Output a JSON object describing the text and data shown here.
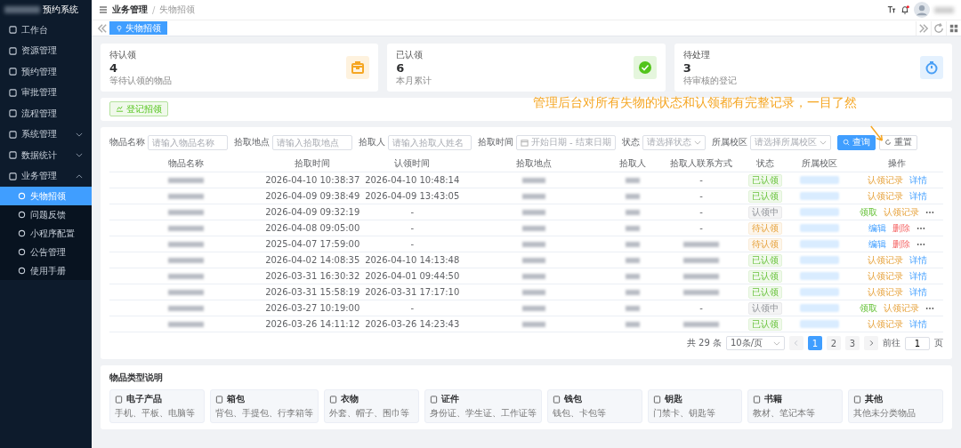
{
  "sidebar": {
    "title": "预约系统",
    "items": [
      {
        "label": "工作台"
      },
      {
        "label": "资源管理"
      },
      {
        "label": "预约管理"
      },
      {
        "label": "审批管理"
      },
      {
        "label": "流程管理"
      },
      {
        "label": "系统管理",
        "expanded": false
      },
      {
        "label": "数据统计",
        "expanded": false
      },
      {
        "label": "业务管理",
        "expanded": true,
        "children": [
          {
            "label": "失物招领",
            "selected": true
          },
          {
            "label": "问题反馈",
            "selected": false
          },
          {
            "label": "小程序配置",
            "selected": false
          },
          {
            "label": "公告管理",
            "selected": false
          },
          {
            "label": "使用手册",
            "selected": false
          }
        ]
      }
    ]
  },
  "breadcrumb": [
    "业务管理",
    "失物招领"
  ],
  "breadcrumb_separator": "/",
  "header": {
    "notification": true
  },
  "tabs": [
    {
      "label": "失物招领",
      "selected": true
    }
  ],
  "stats": [
    {
      "title": "待认领",
      "value": "4",
      "sub": "等待认领的物品",
      "kind": "box",
      "color": "#f5a623"
    },
    {
      "title": "已认领",
      "value": "6",
      "sub": "本月累计",
      "kind": "check",
      "color": "#52c41a"
    },
    {
      "title": "待处理",
      "value": "3",
      "sub": "待审核的登记",
      "kind": "timer",
      "color": "#4a9ff5"
    }
  ],
  "register_button": "登记招领",
  "annotation": "管理后台对所有失物的状态和认领都有完整记录，一目了然",
  "filters": [
    {
      "label": "物品名称",
      "placeholder": "请输入物品名称",
      "kind": "text"
    },
    {
      "label": "拾取地点",
      "placeholder": "请输入拾取地点",
      "kind": "text"
    },
    {
      "label": "拾取人",
      "placeholder": "请输入拾取人姓名",
      "kind": "text"
    },
    {
      "label": "拾取时间",
      "placeholder": "开始日期",
      "placeholder_end": "结束日期",
      "separator": "-",
      "kind": "daterange"
    },
    {
      "label": "状态",
      "placeholder": "请选择状态",
      "kind": "select"
    },
    {
      "label": "所属校区",
      "placeholder": "请选择所属校区",
      "kind": "select"
    }
  ],
  "search_button": "查询",
  "reset_button": "重置",
  "table": {
    "columns": [
      "物品名称",
      "拾取时间",
      "认领时间",
      "拾取地点",
      "拾取人",
      "拾取人联系方式",
      "状态",
      "所属校区",
      "操作"
    ],
    "rows": [
      {
        "picked": "2026-04-10 10:38:37",
        "claimed": "2026-04-10 10:48:14",
        "contact": "-",
        "status": {
          "label": "已认领",
          "kind": "claimed"
        },
        "actions": [
          {
            "label": "认领记录",
            "kind": "warning"
          },
          {
            "label": "详情",
            "kind": "primary"
          }
        ]
      },
      {
        "picked": "2026-04-09 09:38:49",
        "claimed": "2026-04-09 13:43:05",
        "contact": "-",
        "status": {
          "label": "已认领",
          "kind": "claimed"
        },
        "actions": [
          {
            "label": "认领记录",
            "kind": "warning"
          },
          {
            "label": "详情",
            "kind": "primary"
          }
        ]
      },
      {
        "picked": "2026-04-09 09:32:19",
        "claimed": "-",
        "contact": "-",
        "status": {
          "label": "认领中",
          "kind": "claiming"
        },
        "actions": [
          {
            "label": "领取",
            "kind": "success"
          },
          {
            "label": "认领记录",
            "kind": "warning"
          },
          {
            "kind": "more"
          }
        ]
      },
      {
        "picked": "2026-04-08 09:05:00",
        "claimed": "-",
        "contact": "-",
        "status": {
          "label": "待认领",
          "kind": "pending"
        },
        "actions": [
          {
            "label": "编辑",
            "kind": "primary"
          },
          {
            "label": "删除",
            "kind": "danger"
          },
          {
            "kind": "more"
          }
        ]
      },
      {
        "picked": "2025-04-07 17:59:00",
        "claimed": "-",
        "status": {
          "label": "待认领",
          "kind": "pending"
        },
        "actions": [
          {
            "label": "编辑",
            "kind": "primary"
          },
          {
            "label": "删除",
            "kind": "danger"
          },
          {
            "kind": "more"
          }
        ]
      },
      {
        "picked": "2026-04-02 14:08:35",
        "claimed": "2026-04-10 14:13:48",
        "status": {
          "label": "已认领",
          "kind": "claimed"
        },
        "actions": [
          {
            "label": "认领记录",
            "kind": "warning"
          },
          {
            "label": "详情",
            "kind": "primary"
          }
        ]
      },
      {
        "picked": "2026-03-31 16:30:32",
        "claimed": "2026-04-01 09:44:50",
        "status": {
          "label": "已认领",
          "kind": "claimed"
        },
        "actions": [
          {
            "label": "认领记录",
            "kind": "warning"
          },
          {
            "label": "详情",
            "kind": "primary"
          }
        ]
      },
      {
        "picked": "2026-03-31 15:58:19",
        "claimed": "2026-03-31 17:17:10",
        "status": {
          "label": "已认领",
          "kind": "claimed"
        },
        "actions": [
          {
            "label": "认领记录",
            "kind": "warning"
          },
          {
            "label": "详情",
            "kind": "primary"
          }
        ]
      },
      {
        "picked": "2026-03-27 10:19:00",
        "claimed": "-",
        "contact": "-",
        "status": {
          "label": "认领中",
          "kind": "claiming"
        },
        "actions": [
          {
            "label": "领取",
            "kind": "success"
          },
          {
            "label": "认领记录",
            "kind": "warning"
          },
          {
            "kind": "more"
          }
        ]
      },
      {
        "picked": "2026-03-26 14:11:12",
        "claimed": "2026-03-26 14:23:43",
        "status": {
          "label": "已认领",
          "kind": "claimed"
        },
        "actions": [
          {
            "label": "认领记录",
            "kind": "warning"
          },
          {
            "label": "详情",
            "kind": "primary"
          }
        ]
      }
    ]
  },
  "pagination": {
    "total": "共 29 条",
    "page_size": "10条/页",
    "pages": [
      {
        "label": "1",
        "selected": true
      },
      {
        "label": "2",
        "selected": false
      },
      {
        "label": "3",
        "selected": false
      }
    ],
    "goto_label": "前往",
    "goto_value": "1",
    "goto_suffix": "页"
  },
  "types": {
    "title": "物品类型说明",
    "items": [
      {
        "name": "电子产品",
        "desc": "手机、平板、电脑等"
      },
      {
        "name": "箱包",
        "desc": "背包、手提包、行李箱等"
      },
      {
        "name": "衣物",
        "desc": "外套、帽子、围巾等"
      },
      {
        "name": "证件",
        "desc": "身份证、学生证、工作证等"
      },
      {
        "name": "钱包",
        "desc": "钱包、卡包等"
      },
      {
        "name": "钥匙",
        "desc": "门禁卡、钥匙等"
      },
      {
        "name": "书籍",
        "desc": "教材、笔记本等"
      },
      {
        "name": "其他",
        "desc": "其他未分类物品"
      }
    ]
  }
}
